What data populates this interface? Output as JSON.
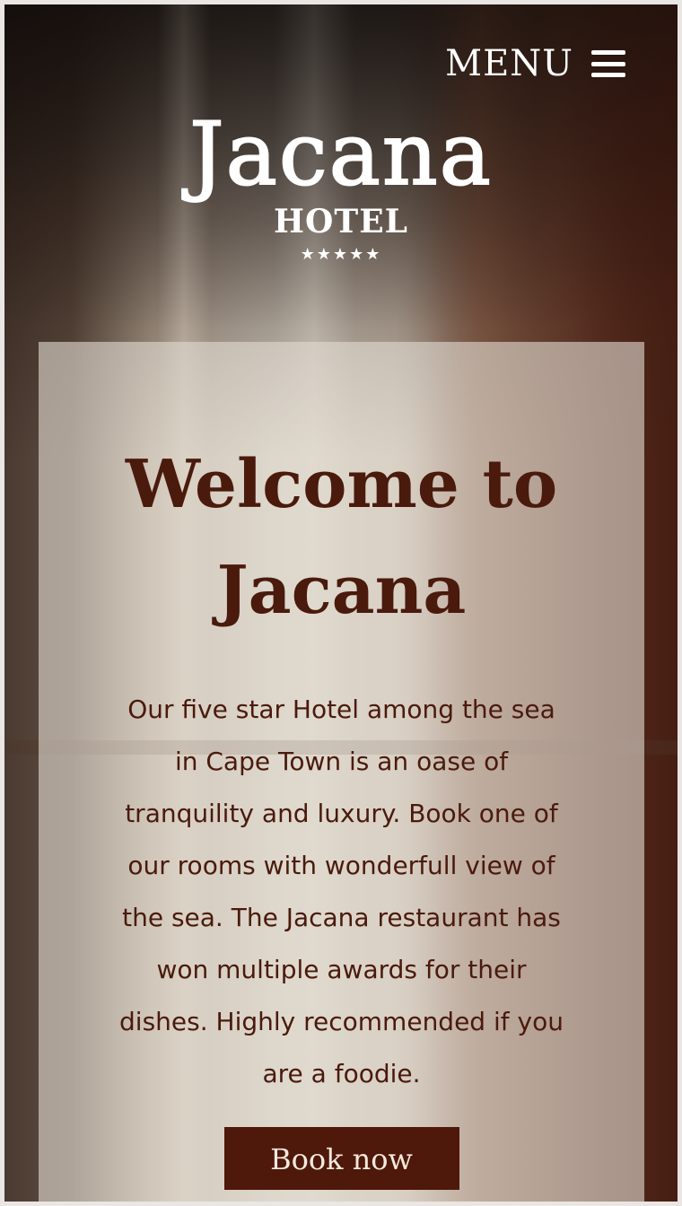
{
  "header": {
    "menu_label": "MENU",
    "menu_icon": "hamburger-icon"
  },
  "logo": {
    "name": "Jacana",
    "subtitle": "HOTEL",
    "stars": "★★★★★"
  },
  "hero": {
    "background_image": "hotel-room-curtains-photo",
    "title": "Welcome to Jacana",
    "body": "Our five star Hotel among the sea in Cape Town is an oase of tranquility and luxury. Book one of our rooms with wonderfull view of the sea. The Jacana restaurant has won multiple awards for their dishes. Highly recommended if you are a foodie.",
    "button_label": "Book now"
  },
  "colors": {
    "accent": "#4e180a",
    "text_dark": "#4a1a0c",
    "card_bg": "rgba(225,218,208,0.62)"
  }
}
